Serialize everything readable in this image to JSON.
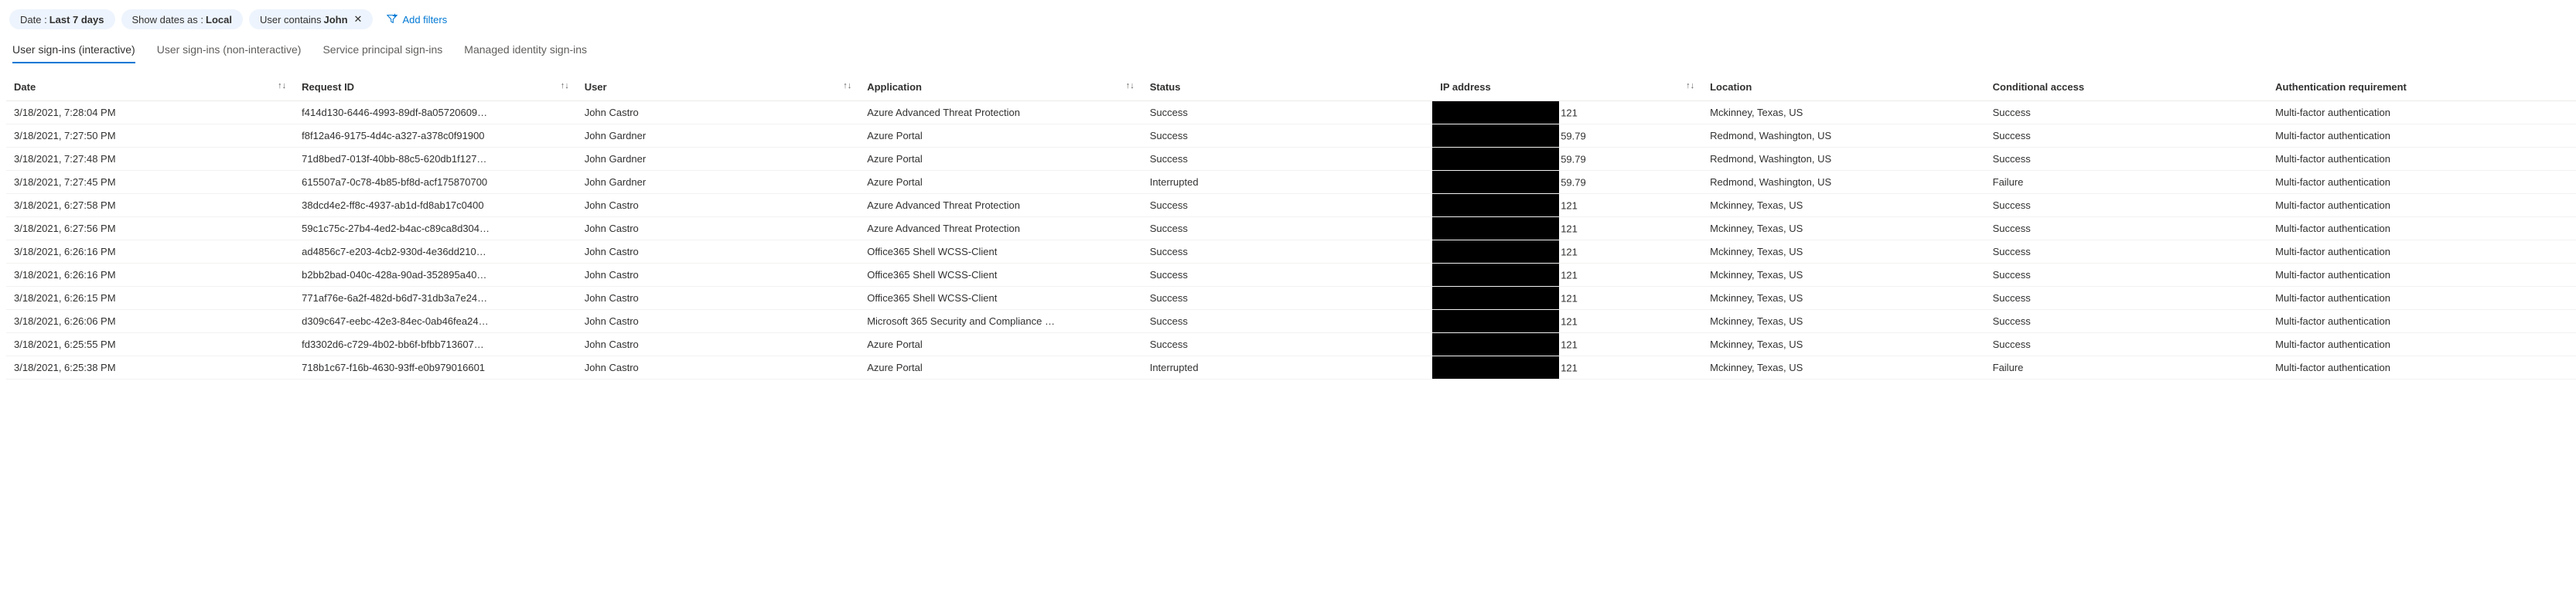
{
  "filters": {
    "date": {
      "prefix": "Date : ",
      "value": "Last 7 days"
    },
    "dates_as": {
      "prefix": "Show dates as : ",
      "value": "Local"
    },
    "user": {
      "prefix": "User contains ",
      "value": "John"
    },
    "add_label": "Add filters"
  },
  "tabs": [
    {
      "id": "interactive",
      "label": "User sign-ins (interactive)",
      "active": true
    },
    {
      "id": "noninteractive",
      "label": "User sign-ins (non-interactive)"
    },
    {
      "id": "service-principal",
      "label": "Service principal sign-ins"
    },
    {
      "id": "managed-identity",
      "label": "Managed identity sign-ins"
    }
  ],
  "columns": {
    "date": "Date",
    "request_id": "Request ID",
    "user": "User",
    "application": "Application",
    "status": "Status",
    "ip": "IP address",
    "location": "Location",
    "conditional_access": "Conditional access",
    "auth_req": "Authentication requirement"
  },
  "sort_glyph": "↑↓",
  "rows": [
    {
      "date": "3/18/2021, 7:28:04 PM",
      "request_id": "f414d130-6446-4993-89df-8a05720609…",
      "user": "John Castro",
      "app": "Azure Advanced Threat Protection",
      "status": "Success",
      "ip_suffix": "121",
      "location": "Mckinney, Texas, US",
      "cond": "Success",
      "auth": "Multi-factor authentication"
    },
    {
      "date": "3/18/2021, 7:27:50 PM",
      "request_id": "f8f12a46-9175-4d4c-a327-a378c0f91900",
      "user": "John Gardner",
      "app": "Azure Portal",
      "status": "Success",
      "ip_suffix": "59.79",
      "location": "Redmond, Washington, US",
      "cond": "Success",
      "auth": "Multi-factor authentication"
    },
    {
      "date": "3/18/2021, 7:27:48 PM",
      "request_id": "71d8bed7-013f-40bb-88c5-620db1f127…",
      "user": "John Gardner",
      "app": "Azure Portal",
      "status": "Success",
      "ip_suffix": "59.79",
      "location": "Redmond, Washington, US",
      "cond": "Success",
      "auth": "Multi-factor authentication"
    },
    {
      "date": "3/18/2021, 7:27:45 PM",
      "request_id": "615507a7-0c78-4b85-bf8d-acf175870700",
      "user": "John Gardner",
      "app": "Azure Portal",
      "status": "Interrupted",
      "ip_suffix": "59.79",
      "location": "Redmond, Washington, US",
      "cond": "Failure",
      "auth": "Multi-factor authentication"
    },
    {
      "date": "3/18/2021, 6:27:58 PM",
      "request_id": "38dcd4e2-ff8c-4937-ab1d-fd8ab17c0400",
      "user": "John Castro",
      "app": "Azure Advanced Threat Protection",
      "status": "Success",
      "ip_suffix": "121",
      "location": "Mckinney, Texas, US",
      "cond": "Success",
      "auth": "Multi-factor authentication"
    },
    {
      "date": "3/18/2021, 6:27:56 PM",
      "request_id": "59c1c75c-27b4-4ed2-b4ac-c89ca8d304…",
      "user": "John Castro",
      "app": "Azure Advanced Threat Protection",
      "status": "Success",
      "ip_suffix": "121",
      "location": "Mckinney, Texas, US",
      "cond": "Success",
      "auth": "Multi-factor authentication"
    },
    {
      "date": "3/18/2021, 6:26:16 PM",
      "request_id": "ad4856c7-e203-4cb2-930d-4e36dd210…",
      "user": "John Castro",
      "app": "Office365 Shell WCSS-Client",
      "status": "Success",
      "ip_suffix": "121",
      "location": "Mckinney, Texas, US",
      "cond": "Success",
      "auth": "Multi-factor authentication"
    },
    {
      "date": "3/18/2021, 6:26:16 PM",
      "request_id": "b2bb2bad-040c-428a-90ad-352895a40…",
      "user": "John Castro",
      "app": "Office365 Shell WCSS-Client",
      "status": "Success",
      "ip_suffix": "121",
      "location": "Mckinney, Texas, US",
      "cond": "Success",
      "auth": "Multi-factor authentication"
    },
    {
      "date": "3/18/2021, 6:26:15 PM",
      "request_id": "771af76e-6a2f-482d-b6d7-31db3a7e24…",
      "user": "John Castro",
      "app": "Office365 Shell WCSS-Client",
      "status": "Success",
      "ip_suffix": "121",
      "location": "Mckinney, Texas, US",
      "cond": "Success",
      "auth": "Multi-factor authentication"
    },
    {
      "date": "3/18/2021, 6:26:06 PM",
      "request_id": "d309c647-eebc-42e3-84ec-0ab46fea24…",
      "user": "John Castro",
      "app": "Microsoft 365 Security and Compliance …",
      "status": "Success",
      "ip_suffix": "121",
      "location": "Mckinney, Texas, US",
      "cond": "Success",
      "auth": "Multi-factor authentication"
    },
    {
      "date": "3/18/2021, 6:25:55 PM",
      "request_id": "fd3302d6-c729-4b02-bb6f-bfbb713607…",
      "user": "John Castro",
      "app": "Azure Portal",
      "status": "Success",
      "ip_suffix": "121",
      "location": "Mckinney, Texas, US",
      "cond": "Success",
      "auth": "Multi-factor authentication"
    },
    {
      "date": "3/18/2021, 6:25:38 PM",
      "request_id": "718b1c67-f16b-4630-93ff-e0b979016601",
      "user": "John Castro",
      "app": "Azure Portal",
      "status": "Interrupted",
      "ip_suffix": "121",
      "location": "Mckinney, Texas, US",
      "cond": "Failure",
      "auth": "Multi-factor authentication"
    }
  ]
}
